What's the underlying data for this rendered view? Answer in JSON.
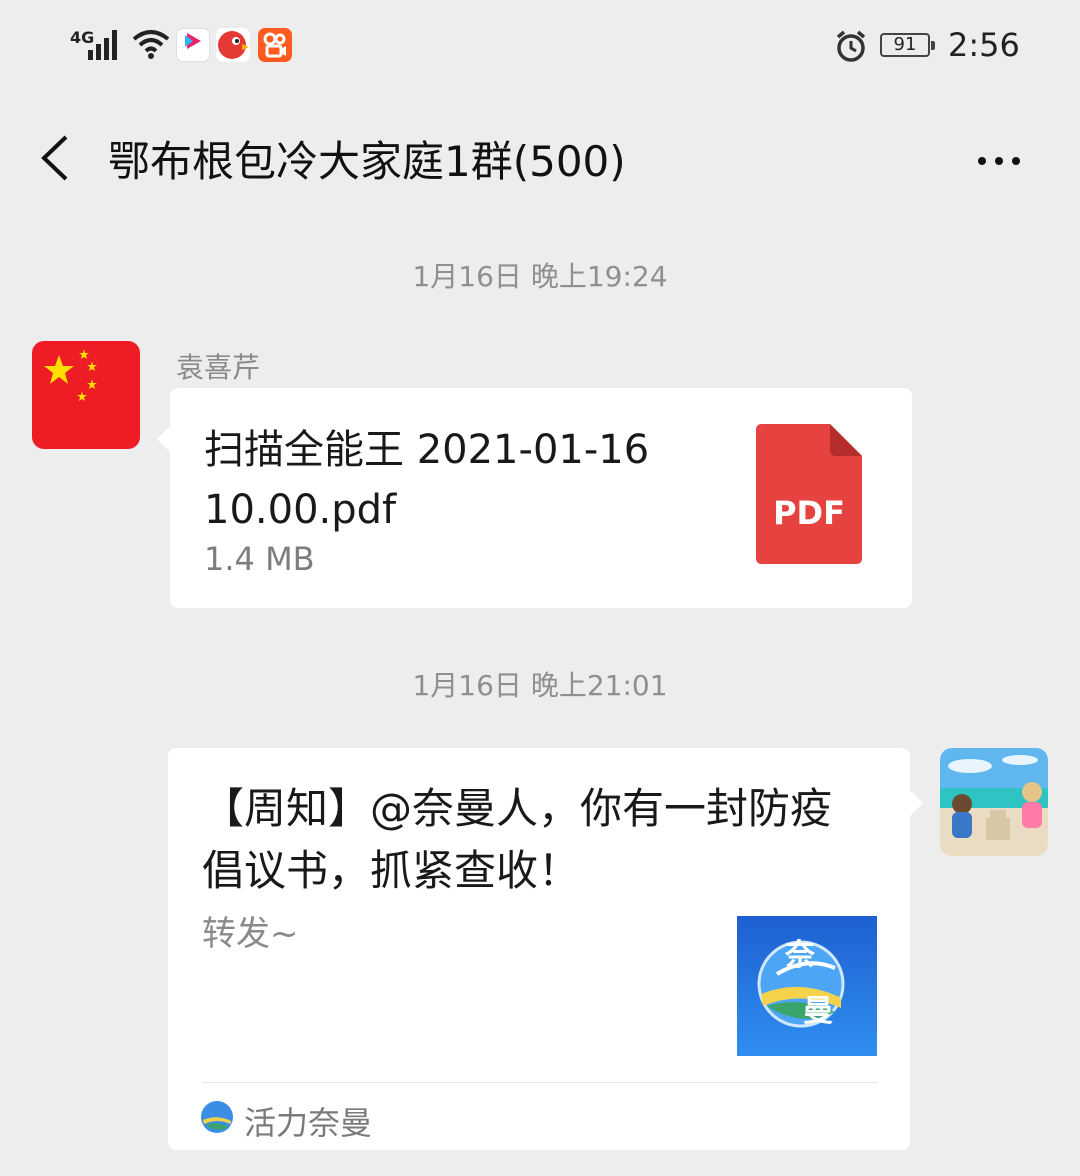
{
  "status_bar": {
    "network": "4G",
    "time": "2:56",
    "battery": "91",
    "icons": [
      "signal-icon",
      "wifi-icon",
      "youku-app-icon",
      "parrot-app-icon",
      "kuaishou-app-icon",
      "alarm-icon",
      "battery-icon"
    ]
  },
  "nav": {
    "title": "鄂布根包冷大家庭1群(500)",
    "back_icon": "chevron-left-icon",
    "more_icon": "more-dots-icon"
  },
  "messages": [
    {
      "timestamp": "1月16日 晚上19:24",
      "sender": "袁喜芹",
      "type": "file",
      "file_name": "扫描全能王 2021-01-16 10.00.pdf",
      "file_size": "1.4 MB",
      "file_icon_label": "PDF",
      "avatar": "china-flag-avatar"
    },
    {
      "timestamp": "1月16日 晚上21:01",
      "type": "link-card",
      "title": "【周知】@奈曼人，你有一封防疫倡议书，抓紧查收！",
      "description": "转发~",
      "source": "活力奈曼",
      "thumbnail_text": [
        "奈",
        "曼"
      ],
      "avatar": "beach-kids-avatar"
    }
  ],
  "colors": {
    "background": "#ededed",
    "bubble": "#ffffff",
    "pdf_red": "#e64340",
    "timestamp": "#8f8f8f"
  }
}
